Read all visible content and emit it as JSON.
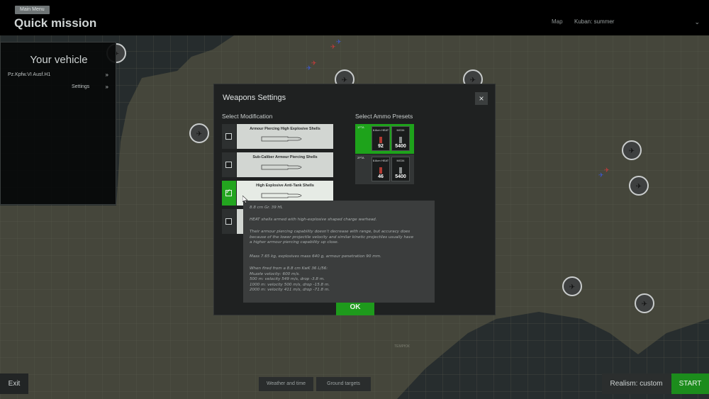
{
  "header": {
    "breadcrumb": "Main Menu",
    "title": "Quick mission",
    "map_label": "Map",
    "map_value": "Kuban: summer"
  },
  "vehicle_panel": {
    "title": "Your vehicle",
    "vehicle_name": "Pz.Kpfw.VI Ausf.H1",
    "settings_label": "Settings"
  },
  "dialog": {
    "title": "Weapons Settings",
    "close_label": "×",
    "select_modification_label": "Select Modification",
    "select_ammo_label": "Select Ammo Presets",
    "ok_label": "OK",
    "modifications": [
      {
        "name": "Armour Piercing High Explosive Shells",
        "checked": false
      },
      {
        "name": "Sub-Caliber Armour Piercing Shells",
        "checked": false
      },
      {
        "name": "High Explosive Anti-Tank Shells",
        "checked": true
      },
      {
        "name": "",
        "checked": false
      }
    ],
    "presets": [
      {
        "id": "1PTA",
        "active": true,
        "slots": [
          {
            "label": "8.8cm HEAT",
            "count": "92"
          },
          {
            "label": "MG34",
            "count": "5400"
          }
        ]
      },
      {
        "id": "2PTA",
        "active": false,
        "slots": [
          {
            "label": "8.8cm HEAT",
            "count": "46"
          },
          {
            "label": "MG34",
            "count": "5400"
          }
        ]
      }
    ]
  },
  "tooltip": {
    "heading": "8.8 cm Gr. 39 HL",
    "desc": "HEAT shells armed with high-explosive shaped charge warhead.",
    "note": [
      "Their armour piercing capability doesn't decrease with range, but accuracy does",
      "because of the lower projectile velocity and similar kinetic projectiles usually have",
      "a higher armour piercing capability up close."
    ],
    "mass": "Mass 7.65 kg, explosives mass 640 g, armour penetration 90 mm.",
    "ballistics": [
      "When fired from a 8.8 cm KwK 36 L/56:",
      "Muzzle velocity: 600 m/s.",
      "500 m: velocity 549 m/s, drop -3.8 m.",
      "1000 m: velocity 500 m/s, drop -15.8 m.",
      "2000 m: velocity 411 m/s, drop -71.8 m."
    ]
  },
  "bottom": {
    "exit_label": "Exit",
    "weather_label": "Weather and time",
    "ground_targets_label": "Ground targets",
    "realism_label": "Realism: custom",
    "start_label": "START"
  },
  "map": {
    "region_label": "ТЕМРЮК"
  },
  "colors": {
    "accent_green": "#1ea31b",
    "map_land": "#49493e",
    "map_sea": "#22282a"
  },
  "icons": {
    "aircraft_marker": "plane-marker-icon",
    "fighter_group": "fighter-group-icon",
    "close": "close-icon",
    "check": "check-icon"
  }
}
